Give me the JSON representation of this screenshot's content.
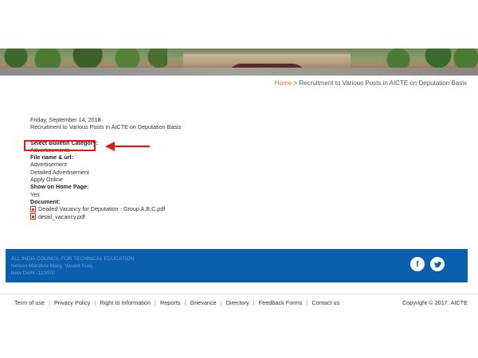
{
  "breadcrumb": {
    "home": "Home",
    "separator": " > ",
    "current": "Recruitment to Various Posts in AICTE on Deputation Basis"
  },
  "article": {
    "date": "Friday, September 14, 2018",
    "title": "Recruitment to Various Posts in AICTE on Deputation Basis",
    "fields": {
      "bulletin_category_label": "Select Bulletin Category:",
      "bulletin_category_value": "Advertisements",
      "file_label": "File name & url:",
      "file_values": [
        "Advertisement",
        "Detailed Advertisement",
        "Apply Online"
      ],
      "home_page_label": "Show on Home Page:",
      "home_page_value": "Yes",
      "document_label": "Document:",
      "documents": [
        "Deailed Vacancy for Deputation - Group A,B,C.pdf",
        "detail_vacancy.pdf"
      ]
    }
  },
  "footer": {
    "org_lines": [
      "ALL INDIA COUNCIL FOR TECHNICAL EDUCATION",
      "Nelson Mandela Marg, Vasant Kunj,",
      "New Delhi -110070"
    ],
    "social": {
      "facebook": "f",
      "twitter": "t"
    },
    "links": [
      "Term of use",
      "Privacy Policy",
      "Right to Information",
      "Reports",
      "Grievance",
      "Directory",
      "Feedback Forms",
      "Contact us"
    ],
    "copyright": "Copyright © 2017. AICTE"
  },
  "colors": {
    "accent": "#e8712c",
    "footer_blue": "#0a60ae",
    "highlight_red": "#e01b1b"
  },
  "icons": {
    "document": "pdf-icon",
    "facebook": "facebook-icon",
    "twitter": "twitter-icon"
  }
}
